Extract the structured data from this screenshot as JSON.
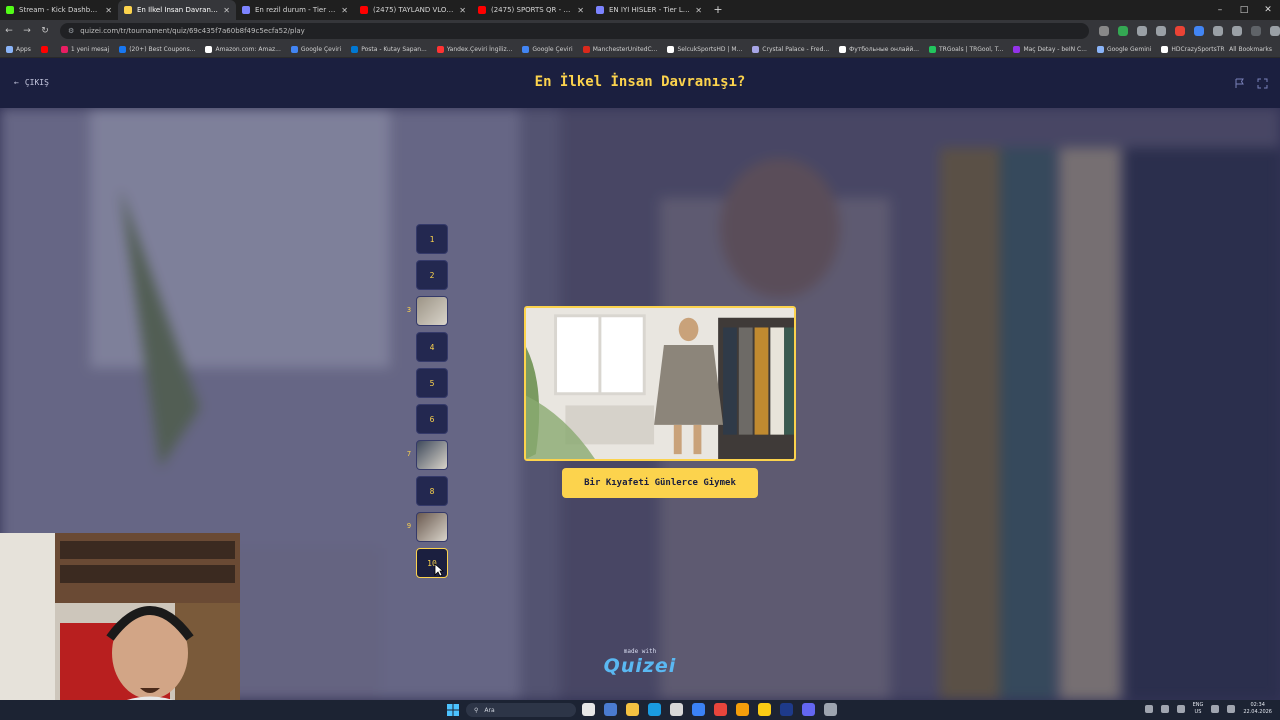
{
  "browser": {
    "tabs": [
      {
        "title": "Stream - Kick Dashboard",
        "color": "#53fc18",
        "active": false
      },
      {
        "title": "En İlkel İnsan Davranışı? - Tier L",
        "color": "#fcd34d",
        "active": true
      },
      {
        "title": "En rezil durum - Tier List | Kör S",
        "color": "#7c83ff",
        "active": false
      },
      {
        "title": "(2475) TAYLAND VLOG | İLK GÜ",
        "color": "#ff0000",
        "active": false
      },
      {
        "title": "(2475) SPORTS QR - YouTube",
        "color": "#ff0000",
        "active": false
      },
      {
        "title": "EN İYİ HİSLER - Tier List | Kör S",
        "color": "#7c83ff",
        "active": false
      }
    ],
    "url": "quizei.com/tr/tournament/quiz/69c435f7a60b8f49c5ecfa52/play",
    "bookmarks": [
      {
        "label": "Apps",
        "color": "#8ab4f8"
      },
      {
        "label": "",
        "color": "#ff0000"
      },
      {
        "label": "1 yeni mesaj",
        "color": "#e91e63"
      },
      {
        "label": "(20+) Best Coupons...",
        "color": "#1877f2"
      },
      {
        "label": "Amazon.com: Amaz...",
        "color": "#ffffff"
      },
      {
        "label": "Google Çeviri",
        "color": "#4285f4"
      },
      {
        "label": "Posta - Kutay Sapan...",
        "color": "#0078d4"
      },
      {
        "label": "Yandex.Çeviri İngiliz...",
        "color": "#ff3333"
      },
      {
        "label": "Google Çeviri",
        "color": "#4285f4"
      },
      {
        "label": "ManchesterUnitedC...",
        "color": "#da291c"
      },
      {
        "label": "SelcukSportsHD | M...",
        "color": "#ffffff"
      },
      {
        "label": "Crystal Palace - Fred...",
        "color": "#a7a5e6"
      },
      {
        "label": "Футбольные онлайй...",
        "color": "#ffffff"
      },
      {
        "label": "TRGoals | TRGool, T...",
        "color": "#22c55e"
      },
      {
        "label": "Maç Detay - beIN C...",
        "color": "#9333ea"
      },
      {
        "label": "Google Gemini",
        "color": "#8ab4f8"
      },
      {
        "label": "HDCrazySportsTR",
        "color": "#ffffff"
      }
    ],
    "all_bookmarks": "All Bookmarks"
  },
  "app": {
    "exit_label": "ÇIKIŞ",
    "title": "En İlkel İnsan Davranışı?",
    "accent": "#fcd34d",
    "header_bg": "#1b1f3f",
    "rounds": [
      {
        "label": "1",
        "state": "pending",
        "side_label": ""
      },
      {
        "label": "2",
        "state": "pending",
        "side_label": ""
      },
      {
        "label": "",
        "state": "done",
        "side_label": "3"
      },
      {
        "label": "4",
        "state": "pending",
        "side_label": ""
      },
      {
        "label": "5",
        "state": "pending",
        "side_label": ""
      },
      {
        "label": "6",
        "state": "pending",
        "side_label": ""
      },
      {
        "label": "",
        "state": "done",
        "side_label": "7"
      },
      {
        "label": "8",
        "state": "pending",
        "side_label": ""
      },
      {
        "label": "",
        "state": "done",
        "side_label": "9"
      },
      {
        "label": "10",
        "state": "current",
        "side_label": ""
      }
    ],
    "answer_label": "Bir Kıyafeti Günlerce Giymek",
    "brand_small": "made with",
    "brand_logo": "Quizei"
  },
  "taskbar": {
    "search_placeholder": "Ara",
    "lang_top": "ENG",
    "lang_bottom": "US",
    "time": "02:34",
    "date": "22.04.2026"
  }
}
